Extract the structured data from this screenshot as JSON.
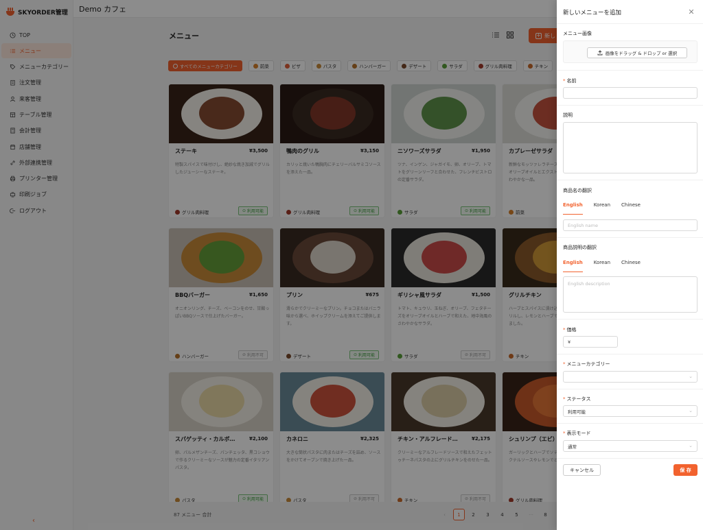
{
  "app": {
    "brand": "SKYORDER管理",
    "store": "Demo カフェ"
  },
  "sidebar": {
    "items": [
      {
        "label": "TOP",
        "icon": "clock-icon"
      },
      {
        "label": "メニュー",
        "icon": "list-icon",
        "active": true
      },
      {
        "label": "メニューカテゴリー",
        "icon": "tag-icon"
      },
      {
        "label": "注文管理",
        "icon": "clipboard-icon"
      },
      {
        "label": "来客管理",
        "icon": "user-icon"
      },
      {
        "label": "テーブル管理",
        "icon": "table-icon"
      },
      {
        "label": "会計管理",
        "icon": "calculator-icon"
      },
      {
        "label": "店舗管理",
        "icon": "store-icon"
      },
      {
        "label": "外部連携管理",
        "icon": "link-icon"
      },
      {
        "label": "プリンター管理",
        "icon": "printer-icon"
      },
      {
        "label": "印刷ジョブ",
        "icon": "print-job-icon"
      },
      {
        "label": "ログアウト",
        "icon": "logout-icon"
      }
    ],
    "collapse_icon": "chevron-left-icon"
  },
  "main": {
    "title": "メニュー",
    "add_label": "新し",
    "filters": [
      {
        "label": "すべてのメニューカテゴリー",
        "active": true,
        "color": "#ffffff"
      },
      {
        "label": "前菜",
        "color": "#d9822b"
      },
      {
        "label": "ピザ",
        "color": "#e0603a"
      },
      {
        "label": "パスタ",
        "color": "#c98a3a"
      },
      {
        "label": "ハンバーガー",
        "color": "#b8742a"
      },
      {
        "label": "デザート",
        "color": "#7a4a2a"
      },
      {
        "label": "サラダ",
        "color": "#5aa03a"
      },
      {
        "label": "グリル肉料理",
        "color": "#a23a2a"
      },
      {
        "label": "チキン",
        "color": "#c86a2a"
      }
    ],
    "cards": [
      {
        "name": "ステーキ",
        "price": "¥3,500",
        "desc": "特製スパイスで味付けし、絶妙な焼き加減でグリルしたジューシーなステーキ。",
        "category": "グリル肉料理",
        "cat_color": "#a23a2a",
        "status": "利用可能",
        "available": true,
        "img_bg": "#3a2418",
        "plate": "#f4f1ea",
        "food": "#7a3a1e"
      },
      {
        "name": "鴨肉のグリル",
        "price": "¥3,150",
        "desc": "カリッと焼いた鴨胸肉にチェリーバルサミコソースを添えた一品。",
        "category": "グリル肉料理",
        "cat_color": "#a23a2a",
        "status": "利用可能",
        "available": true,
        "img_bg": "#2a1a14",
        "plate": "#3a2a22",
        "food": "#8a3a2a"
      },
      {
        "name": "ニソワーズサラダ",
        "price": "¥1,950",
        "desc": "ツナ、インゲン、ジャガイモ、卵、オリーブ、トマトをグリーンリーフと合わせた、フレンチビストロの定番サラダ。",
        "category": "サラダ",
        "cat_color": "#5aa03a",
        "status": "利用可能",
        "available": true,
        "img_bg": "#cfd6d2",
        "plate": "#f2f2ee",
        "food": "#4f8a3a"
      },
      {
        "name": "カプレーゼサラダ",
        "price": "",
        "desc": "新鮮なモッツァレラチーズとトマト、バジルの葉をオリーブオイルとエクストラバージンで仕上げたさわやかな一品。",
        "category": "前菜",
        "cat_color": "#d9822b",
        "status": "",
        "available": true,
        "img_bg": "#dcdcd8",
        "plate": "#f4f4f0",
        "food": "#c0402a"
      },
      {
        "name": "BBQバーガー",
        "price": "¥1,650",
        "desc": "オニオンリング、チーズ、ベーコンをのせ、甘酸っぱいBBQソースで仕上げたバーガー。",
        "category": "ハンバーガー",
        "cat_color": "#b8742a",
        "status": "利用不可",
        "available": false,
        "img_bg": "#c9bfb4",
        "plate": "#c98a3a",
        "food": "#5aa03a"
      },
      {
        "name": "プリン",
        "price": "¥675",
        "desc": "滑らかでクリーミーなプリン。チョコまたはバニラ味から選べ、ホイップクリームを添えてご提供します。",
        "category": "デザート",
        "cat_color": "#7a4a2a",
        "status": "利用可能",
        "available": true,
        "img_bg": "#3a2a22",
        "plate": "#6a4a3a",
        "food": "#eae4dc"
      },
      {
        "name": "ギリシャ風サラダ",
        "price": "¥1,500",
        "desc": "トマト、キュウリ、玉ねぎ、オリーブ、フェタチーズをオリーブオイルとハーブで和えた、地中海風のさわやかなサラダ。",
        "category": "サラダ",
        "cat_color": "#5aa03a",
        "status": "利用不可",
        "available": false,
        "img_bg": "#2a2a2a",
        "plate": "#e8e4da",
        "food": "#c83a3a"
      },
      {
        "name": "グリルチキン",
        "price": "",
        "desc": "ハーブとスパイスに漬け込んだチキンを香ばしくグリルし、レモンとハーブで絶妙な焼き加減に仕上げました。",
        "category": "チキン",
        "cat_color": "#c86a2a",
        "status": "",
        "available": true,
        "img_bg": "#3a2a1a",
        "plate": "#8a5a2a",
        "food": "#d8a03a"
      },
      {
        "name": "スパゲッティ・カルボナーラ",
        "price": "¥2,100",
        "desc": "卵、パルメザンチーズ、パンチェッタ、黒コショウで作るクリーミーなソースが魅力の定番イタリアンパスタ。",
        "category": "パスタ",
        "cat_color": "#c98a3a",
        "status": "利用可能",
        "available": true,
        "img_bg": "#d8d2c6",
        "plate": "#f2eee6",
        "food": "#e8d6a0"
      },
      {
        "name": "カネロニ",
        "price": "¥2,325",
        "desc": "大きな筒状パスタに肉またはチーズを詰め、ソースをかけてオーブンで焼き上げた一品。",
        "category": "パスタ",
        "cat_color": "#c98a3a",
        "status": "利用不可",
        "available": false,
        "img_bg": "#6a8a9a",
        "plate": "#f2eee6",
        "food": "#c8402a"
      },
      {
        "name": "チキン・アルフレードパスタ",
        "price": "¥2,175",
        "desc": "クリーミーなアルフレードソースで和えたフェットゥチーネパスタの上にグリルチキンをのせた一品。",
        "category": "チキン",
        "cat_color": "#c86a2a",
        "status": "利用不可",
        "available": false,
        "img_bg": "#4a3a2a",
        "plate": "#f2eee6",
        "food": "#d8c8a0"
      },
      {
        "name": "シュリンプ（エビ）",
        "price": "",
        "desc": "ガーリックとハーブでソテーした新鮮なエビを、カクテルソースやレモンでどうぞ。",
        "category": "グリル肉料理",
        "cat_color": "#a23a2a",
        "status": "",
        "available": true,
        "img_bg": "#3a2418",
        "plate": "#c85a2a",
        "food": "#e87a3a"
      }
    ],
    "total": "87 メニュー 合計",
    "pager": [
      "1",
      "2",
      "3",
      "4",
      "5",
      "···",
      "8"
    ],
    "pager_prev": "‹"
  },
  "drawer": {
    "title": "新しいメニューを追加",
    "close_icon": "close-icon",
    "image_label": "メニュー画像",
    "upload_label": "画像をドラッグ & ドロップ or 選択",
    "name_label": "名前",
    "desc_label": "説明",
    "name_translation_label": "商品名の翻訳",
    "desc_translation_label": "商品説明の翻訳",
    "lang_tabs": [
      "English",
      "Korean",
      "Chinese"
    ],
    "name_placeholder": "English name",
    "desc_placeholder": "English description",
    "price_label": "価格",
    "price_prefix": "¥",
    "category_label": "メニューカテゴリー",
    "category_value": "",
    "status_label": "ステータス",
    "status_value": "利用可能",
    "display_label": "表示モード",
    "display_value": "通常",
    "cancel_label": "キャンセル",
    "save_label": "保 存"
  },
  "colors": {
    "accent": "#f2622e",
    "available": "#3a9a3a"
  }
}
